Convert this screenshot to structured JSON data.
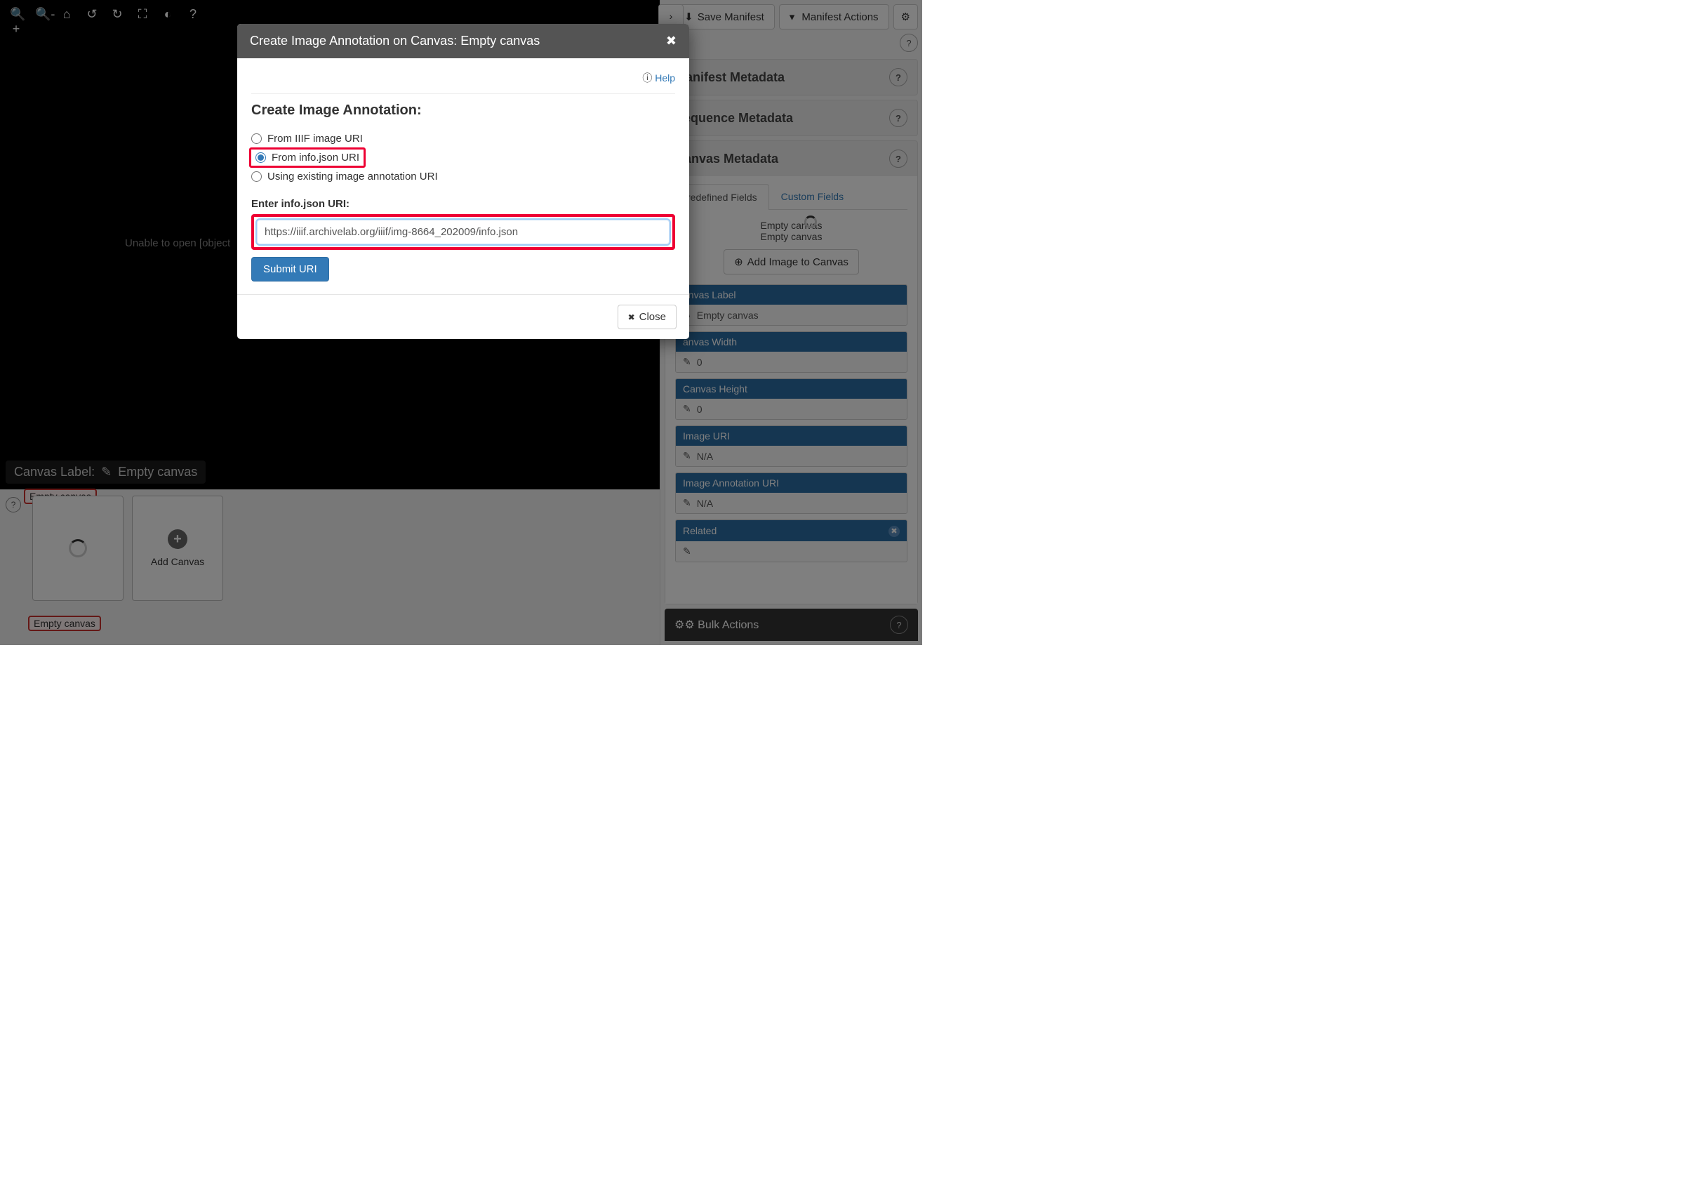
{
  "viewer": {
    "toolbar_icons": [
      "zoom-in",
      "zoom-out",
      "home",
      "rotate-left",
      "rotate-right",
      "fullscreen",
      "contrast",
      "help"
    ],
    "error_msg": "Unable to open [object",
    "canvas_label_prefix": "Canvas Label:",
    "canvas_label_value": "Empty canvas"
  },
  "thumbs": {
    "item_label": "Empty canvas",
    "add_label": "Add Canvas",
    "badge": "Empty canvas"
  },
  "right": {
    "save_btn": "Save Manifest",
    "actions_btn": "Manifest Actions",
    "panels": {
      "manifest": "Manifest Metadata",
      "sequence": "Sequence Metadata",
      "canvas": "Canvas Metadata"
    },
    "tabs": {
      "predefined": "redefined Fields",
      "custom": "Custom Fields"
    },
    "preview_line1": "Empty canvas",
    "preview_line2": "Empty canvas",
    "add_image_btn": "Add Image to Canvas",
    "fields": {
      "label": {
        "head": "anvas Label",
        "value": "Empty canvas"
      },
      "width": {
        "head": "anvas Width",
        "value": "0"
      },
      "height": {
        "head": "Canvas Height",
        "value": "0"
      },
      "image_uri": {
        "head": "Image URI",
        "value": "N/A"
      },
      "anno_uri": {
        "head": "Image Annotation URI",
        "value": "N/A"
      },
      "related": {
        "head": "Related",
        "value": ""
      }
    },
    "bulk": "Bulk Actions"
  },
  "modal": {
    "title": "Create Image Annotation on Canvas: Empty canvas",
    "help": "Help",
    "heading": "Create Image Annotation:",
    "opt1": "From IIIF image URI",
    "opt2": "From info.json URI",
    "opt3": "Using existing image annotation URI",
    "prompt": "Enter info.json URI:",
    "uri_value": "https://iiif.archivelab.org/iiif/img-8664_202009/info.json",
    "submit": "Submit URI",
    "close": "Close"
  }
}
